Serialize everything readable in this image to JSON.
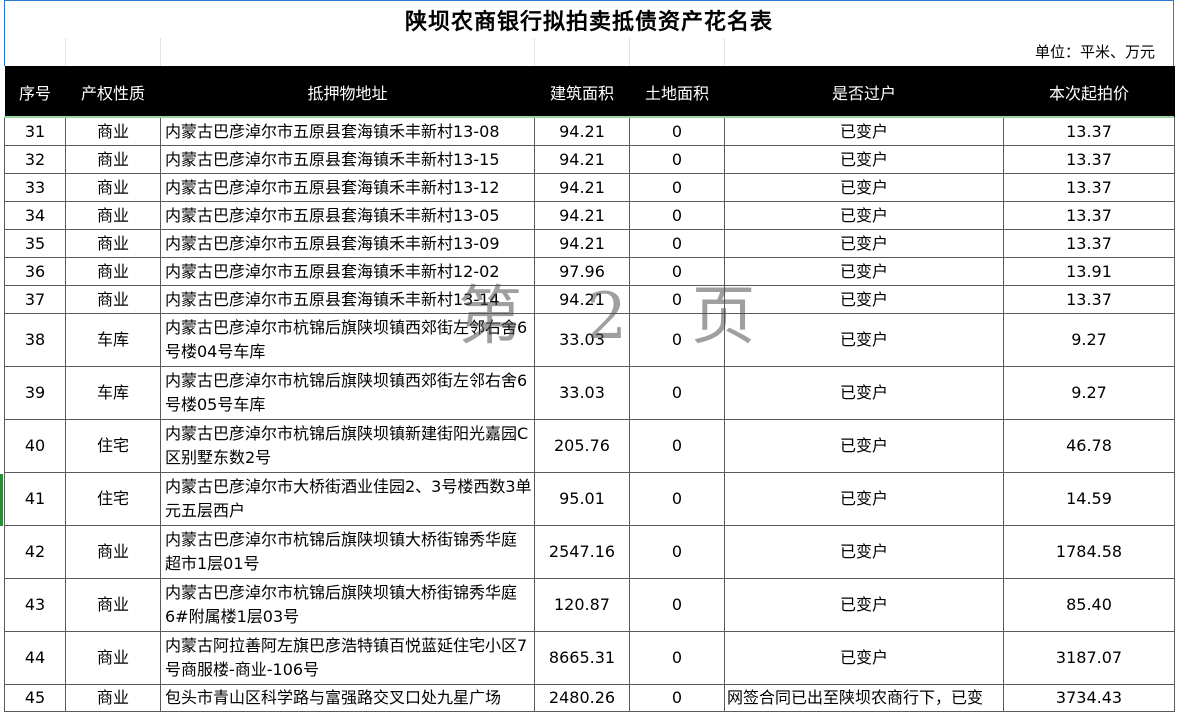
{
  "title": "陕坝农商银行拟拍卖抵债资产花名表",
  "unit": "单位：平米、万元",
  "watermark": "第 2 页",
  "headers": {
    "seq": "序号",
    "property_type": "产权性质",
    "address": "抵押物地址",
    "building_area": "建筑面积",
    "land_area": "土地面积",
    "transferred": "是否过户",
    "start_price": "本次起拍价"
  },
  "rows": [
    {
      "seq": "31",
      "type": "商业",
      "addr": "内蒙古巴彦淖尔市五原县套海镇禾丰新村13-08",
      "area": "94.21",
      "land": "0",
      "status": "已变户",
      "price": "13.37"
    },
    {
      "seq": "32",
      "type": "商业",
      "addr": "内蒙古巴彦淖尔市五原县套海镇禾丰新村13-15",
      "area": "94.21",
      "land": "0",
      "status": "已变户",
      "price": "13.37"
    },
    {
      "seq": "33",
      "type": "商业",
      "addr": "内蒙古巴彦淖尔市五原县套海镇禾丰新村13-12",
      "area": "94.21",
      "land": "0",
      "status": "已变户",
      "price": "13.37"
    },
    {
      "seq": "34",
      "type": "商业",
      "addr": "内蒙古巴彦淖尔市五原县套海镇禾丰新村13-05",
      "area": "94.21",
      "land": "0",
      "status": "已变户",
      "price": "13.37"
    },
    {
      "seq": "35",
      "type": "商业",
      "addr": "内蒙古巴彦淖尔市五原县套海镇禾丰新村13-09",
      "area": "94.21",
      "land": "0",
      "status": "已变户",
      "price": "13.37"
    },
    {
      "seq": "36",
      "type": "商业",
      "addr": "内蒙古巴彦淖尔市五原县套海镇禾丰新村12-02",
      "area": "97.96",
      "land": "0",
      "status": "已变户",
      "price": "13.91"
    },
    {
      "seq": "37",
      "type": "商业",
      "addr": "内蒙古巴彦淖尔市五原县套海镇禾丰新村13-14",
      "area": "94.21",
      "land": "0",
      "status": "已变户",
      "price": "13.37"
    },
    {
      "seq": "38",
      "type": "车库",
      "addr": "内蒙古巴彦淖尔市杭锦后旗陕坝镇西郊街左邻右舍6号楼04号车库",
      "area": "33.03",
      "land": "0",
      "status": "已变户",
      "price": "9.27"
    },
    {
      "seq": "39",
      "type": "车库",
      "addr": "内蒙古巴彦淖尔市杭锦后旗陕坝镇西郊街左邻右舍6号楼05号车库",
      "area": "33.03",
      "land": "0",
      "status": "已变户",
      "price": "9.27"
    },
    {
      "seq": "40",
      "type": "住宅",
      "addr": "内蒙古巴彦淖尔市杭锦后旗陕坝镇新建街阳光嘉园C区别墅东数2号",
      "area": "205.76",
      "land": "0",
      "status": "已变户",
      "price": "46.78"
    },
    {
      "seq": "41",
      "type": "住宅",
      "addr": "内蒙古巴彦淖尔市大桥街酒业佳园2、3号楼西数3单元五层西户",
      "area": "95.01",
      "land": "0",
      "status": "已变户",
      "price": "14.59"
    },
    {
      "seq": "42",
      "type": "商业",
      "addr": "内蒙古巴彦淖尔市杭锦后旗陕坝镇大桥街锦秀华庭超市1层01号",
      "area": "2547.16",
      "land": "0",
      "status": "已变户",
      "price": "1784.58"
    },
    {
      "seq": "43",
      "type": "商业",
      "addr": "内蒙古巴彦淖尔市杭锦后旗陕坝镇大桥街锦秀华庭6#附属楼1层03号",
      "area": "120.87",
      "land": "0",
      "status": "已变户",
      "price": "85.40"
    },
    {
      "seq": "44",
      "type": "商业",
      "addr": "内蒙古阿拉善阿左旗巴彦浩特镇百悦蓝延住宅小区7号商服楼-商业-106号",
      "area": "8665.31",
      "land": "0",
      "status": "已变户",
      "price": "3187.07"
    },
    {
      "seq": "45",
      "type": "商业",
      "addr": "包头市青山区科学路与富强路交叉口处九星广场",
      "area": "2480.26",
      "land": "0",
      "status": "网签合同已出至陕坝农商行下，已变",
      "price": "3734.43"
    }
  ]
}
